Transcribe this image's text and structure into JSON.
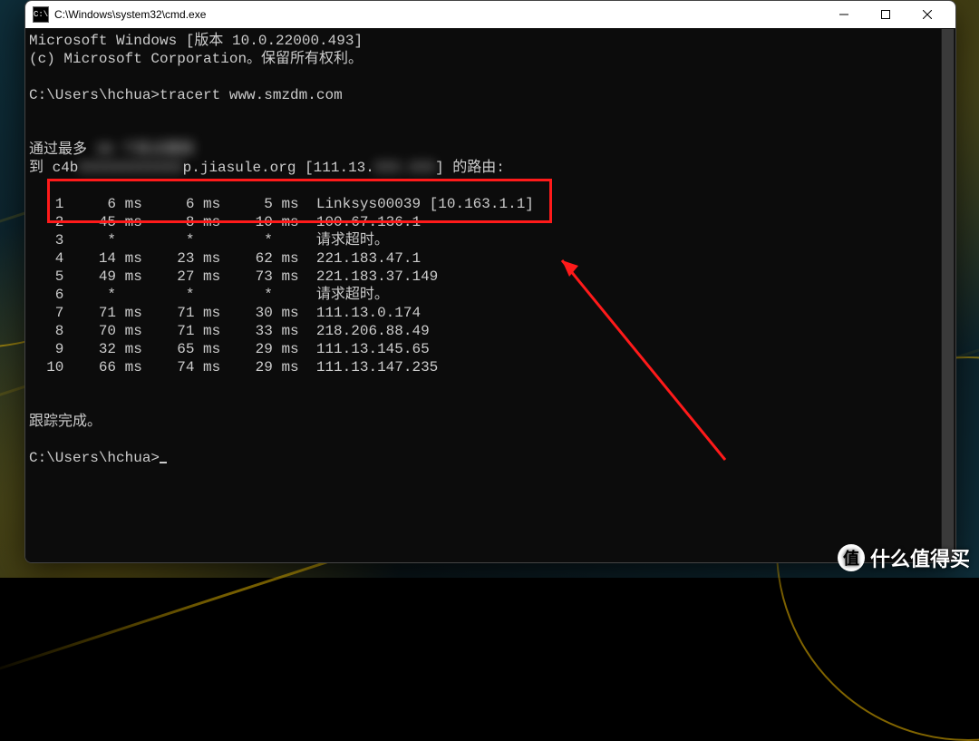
{
  "window": {
    "title": "C:\\Windows\\system32\\cmd.exe",
    "cmd_icon_text": "C:\\"
  },
  "banner": {
    "line1": "Microsoft Windows [版本 10.0.22000.493]",
    "line2": "(c) Microsoft Corporation。保留所有权利。"
  },
  "prompt1": {
    "prompt": "C:\\Users\\hchua>",
    "command": "tracert www.smzdm.com"
  },
  "trace_header": {
    "line1_pre": "通过最多 ",
    "line1_blur": "30 个跃点跟踪",
    "line2_pre": "到 c4b",
    "line2_blur": "XXXXXXXXXXXX",
    "line2_mid": "p.jiasule.org [111.13.",
    "line2_blur2": "XXX.XXX",
    "line2_post": "] 的路由:"
  },
  "hops": [
    {
      "n": " 1",
      "t1": "    6 ms",
      "t2": "    6 ms",
      "t3": "    5 ms",
      "host": "Linksys00039 [10.163.1.1]"
    },
    {
      "n": " 2",
      "t1": "   45 ms",
      "t2": "    8 ms",
      "t3": "   10 ms",
      "host": "100.67.136.1"
    },
    {
      "n": " 3",
      "t1": "    *   ",
      "t2": "    *   ",
      "t3": "    *   ",
      "host": "请求超时。"
    },
    {
      "n": " 4",
      "t1": "   14 ms",
      "t2": "   23 ms",
      "t3": "   62 ms",
      "host": "221.183.47.1"
    },
    {
      "n": " 5",
      "t1": "   49 ms",
      "t2": "   27 ms",
      "t3": "   73 ms",
      "host": "221.183.37.149"
    },
    {
      "n": " 6",
      "t1": "    *   ",
      "t2": "    *   ",
      "t3": "    *   ",
      "host": "请求超时。"
    },
    {
      "n": " 7",
      "t1": "   71 ms",
      "t2": "   71 ms",
      "t3": "   30 ms",
      "host": "111.13.0.174"
    },
    {
      "n": " 8",
      "t1": "   70 ms",
      "t2": "   71 ms",
      "t3": "   33 ms",
      "host": "218.206.88.49"
    },
    {
      "n": " 9",
      "t1": "   32 ms",
      "t2": "   65 ms",
      "t3": "   29 ms",
      "host": "111.13.145.65"
    },
    {
      "n": "10",
      "t1": "   66 ms",
      "t2": "   74 ms",
      "t3": "   29 ms",
      "host": "111.13.147.235"
    }
  ],
  "trace_done": "跟踪完成。",
  "prompt2": "C:\\Users\\hchua>",
  "watermark": {
    "badge": "值",
    "text": "什么值得买"
  }
}
